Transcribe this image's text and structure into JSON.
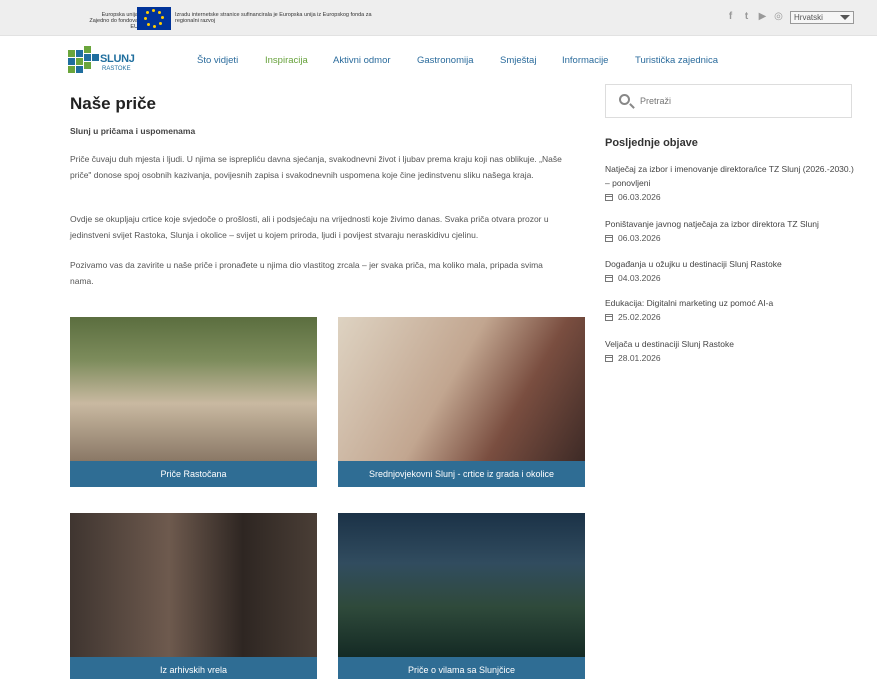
{
  "eu_bar": {
    "left_text": "Europska unija Zajedno do fondova EU",
    "right_text": "Izradu internetske stranice sufinancirala je Europska unija iz Europskog fonda za regionalni razvoj",
    "language": "Hrvatski"
  },
  "logo": {
    "name": "SLUNJ",
    "sub": "RASTOKE"
  },
  "nav": {
    "items": [
      "Što vidjeti",
      "Inspiracija",
      "Aktivni odmor",
      "Gastronomija",
      "Smještaj",
      "Informacije",
      "Turistička zajednica"
    ],
    "active_index": 1
  },
  "main": {
    "title": "Naše priče",
    "subtitle": "Slunj u pričama i uspomenama",
    "paragraphs": [
      "Priče čuvaju duh mjesta i ljudi. U njima se isprepliću davna sjećanja, svakodnevni život i ljubav prema kraju koji nas oblikuje. „Naše priče\" donose spoj osobnih kazivanja, povijesnih zapisa i svakodnevnih uspomena koje čine jedinstvenu sliku našega kraja.",
      "Ovdje se okupljaju crtice koje svjedoče o prošlosti, ali i podsjećaju na vrijednosti koje živimo danas. Svaka priča otvara prozor u jedinstveni svijet Rastoka, Slunja i okolice – svijet u kojem priroda, ljudi i povijest stvaraju neraskidivu cjelinu.",
      "Pozivamo vas da zavirite u naše priče i pronađete u njima dio vlastitog zrcala – jer svaka priča, ma koliko mala, pripada svima nama."
    ],
    "cards": [
      {
        "caption": "Priče Rastočana"
      },
      {
        "caption": "Srednjovjekovni Slunj - crtice iz grada i okolice"
      },
      {
        "caption": "Iz arhivskih vrela"
      },
      {
        "caption": "Priče o vilama sa Slunjčice"
      }
    ]
  },
  "sidebar": {
    "search_placeholder": "Pretraži",
    "recent_title": "Posljednje objave",
    "posts": [
      {
        "title": "Natječaj za izbor i imenovanje direktora/ice TZ Slunj (2026.-2030.) – ponovljeni",
        "date": "06.03.2026"
      },
      {
        "title": "Poništavanje javnog natječaja za izbor direktora TZ Slunj",
        "date": "06.03.2026"
      },
      {
        "title": "Događanja u ožujku u destinaciji Slunj Rastoke",
        "date": "04.03.2026"
      },
      {
        "title": "Edukacija: Digitalni marketing uz pomoć AI-a",
        "date": "25.02.2026"
      },
      {
        "title": "Veljača u destinaciji Slunj Rastoke",
        "date": "28.01.2026"
      }
    ]
  },
  "colors": {
    "nav_link": "#2a6b9c",
    "nav_active": "#66a13a",
    "caption_bg": "#2f6d94",
    "eu_blue": "#003399",
    "eu_star": "#ffcc00"
  },
  "icons": {
    "social": [
      "facebook-icon",
      "twitter-icon",
      "youtube-icon",
      "instagram-icon"
    ],
    "search": "search-icon",
    "calendar": "calendar-icon"
  }
}
